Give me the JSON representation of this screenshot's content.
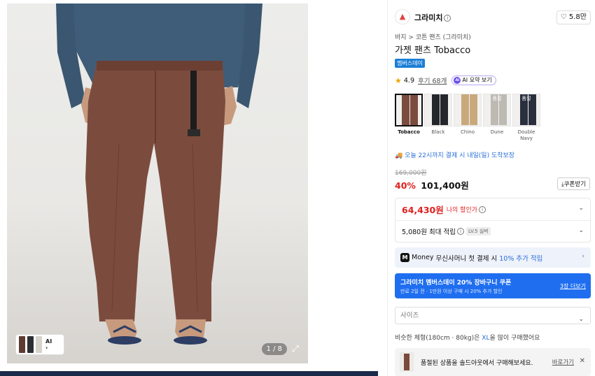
{
  "gallery": {
    "counter": "1 / 8",
    "thumb_ai_label": "AI",
    "thumb_chevron": "›",
    "expand_icon": "expand-icon",
    "colors": {
      "shirt": "#3f5d78",
      "pants": "#7b4c3e",
      "pants_dark": "#5e3529",
      "skin": "#c79a7d",
      "sandal": "#2d3d63"
    }
  },
  "brand": {
    "name": "그라미치",
    "info_icon": "i",
    "like_count": "5.8만"
  },
  "breadcrumb": "바지 > 코튼 팬츠 (그라미치)",
  "product": {
    "title": "가젯 팬츠 Tobacco",
    "badge": "멤버스데이",
    "rating": "4.9",
    "review_link": "후기 68개",
    "ai_summary": "AI 요약 보기",
    "ai_icon_text": "AI"
  },
  "swatches": [
    {
      "label": "Tobacco",
      "selected": true,
      "color": "#7b4c3e",
      "soldout": ""
    },
    {
      "label": "Black",
      "selected": false,
      "color": "#23262b",
      "soldout": ""
    },
    {
      "label": "Chino",
      "selected": false,
      "color": "#c9a97c",
      "soldout": ""
    },
    {
      "label": "Dune",
      "selected": false,
      "color": "#bdbab3",
      "soldout": "품절"
    },
    {
      "label": "Double Navy",
      "selected": false,
      "color": "#2a2f3d",
      "soldout": "품절"
    }
  ],
  "delivery": "오늘 22시까지 결제 시 내일(일) 도착보장",
  "price": {
    "original": "169,000원",
    "discount": "40%",
    "sale": "101,400원",
    "coupon_button": "쿠폰받기",
    "my_price": "64,430원",
    "my_price_label": "나의 할인가",
    "points": "5,080원 최대 적립",
    "level": "LV.5 실버"
  },
  "money": {
    "prefix": "Money",
    "text": "무신사머니 첫 결제 시",
    "highlight": "10% 추가 적립"
  },
  "coupon_banner": {
    "title": "그라미치 멤버스데이 20% 장바구니 쿠폰",
    "subtitle": "만료 2일 전 · 1만원 이상 구매 시 20% 추가 할인",
    "more": "3장 더보기"
  },
  "size": {
    "placeholder": "사이즈"
  },
  "similar": {
    "prefix": "비슷한 체형(180cm · 80kg)은",
    "size": "XL",
    "suffix": "을 많이 구매했어요"
  },
  "soldout": {
    "text": "품절된 상품을 솔드아웃에서 구매해보세요.",
    "link": "바로가기"
  }
}
